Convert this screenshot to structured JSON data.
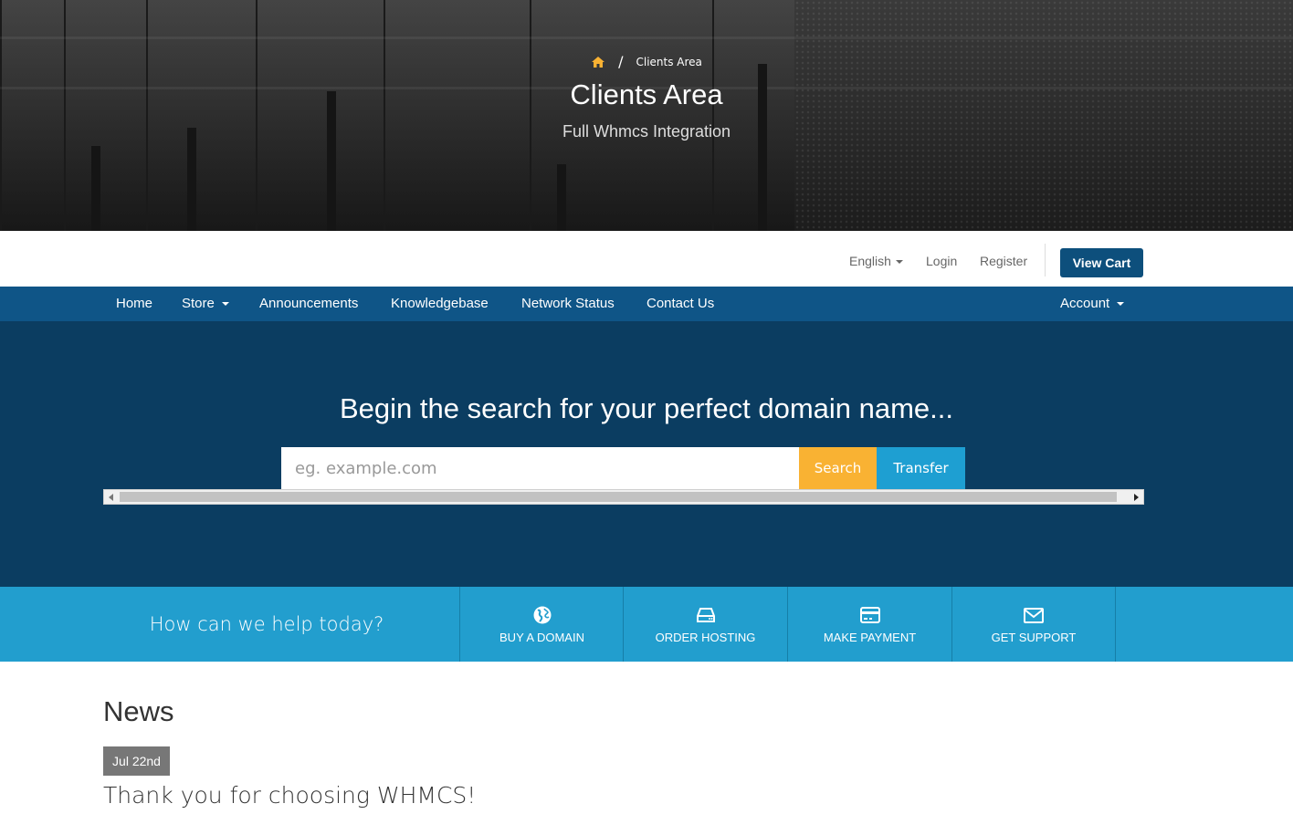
{
  "hero": {
    "breadcrumb_current": "Clients Area",
    "breadcrumb_separator": "/",
    "title": "Clients Area",
    "subtitle": "Full Whmcs Integration",
    "home_icon_color": "#f9b233"
  },
  "topbar": {
    "language": "English",
    "login": "Login",
    "register": "Register",
    "view_cart": "View Cart"
  },
  "nav": {
    "items": [
      "Home",
      "Store",
      "Announcements",
      "Knowledgebase",
      "Network Status",
      "Contact Us"
    ],
    "account": "Account"
  },
  "domain": {
    "title": "Begin the search for your perfect domain name...",
    "placeholder": "eg. example.com",
    "search_label": "Search",
    "transfer_label": "Transfer"
  },
  "help": {
    "prompt": "How can we help today?",
    "actions": [
      {
        "label": "BUY A DOMAIN",
        "icon": "globe-icon"
      },
      {
        "label": "ORDER HOSTING",
        "icon": "hard-drive-icon"
      },
      {
        "label": "MAKE PAYMENT",
        "icon": "credit-card-icon"
      },
      {
        "label": "GET SUPPORT",
        "icon": "envelope-icon"
      }
    ]
  },
  "news": {
    "heading": "News",
    "items": [
      {
        "date": "Jul 22nd",
        "title": "Thank you for choosing WHMCS!"
      }
    ]
  },
  "colors": {
    "nav_bg": "#0f5587",
    "domain_bg": "#0b3d61",
    "search_button": "#f9b233",
    "transfer_button": "#1e9fd2",
    "help_bar": "#229ece",
    "view_cart_bg": "#0d4f7c"
  }
}
